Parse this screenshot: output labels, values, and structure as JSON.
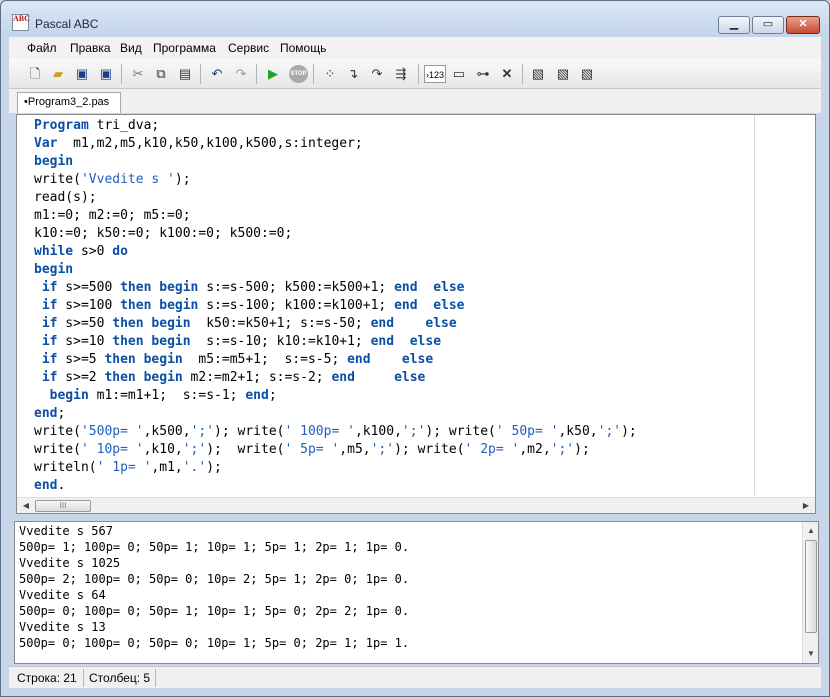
{
  "window": {
    "title": "Pascal ABC",
    "icon_text": "ABC"
  },
  "menu": [
    "Файл",
    "Правка",
    "Вид",
    "Программа",
    "Сервис",
    "Помощь"
  ],
  "toolbar": {
    "icons": [
      "new-file-icon",
      "open-file-icon",
      "save-icon",
      "save-all-icon",
      "cut-icon",
      "copy-icon",
      "paste-icon",
      "undo-icon",
      "redo-icon",
      "run-icon",
      "stop-icon",
      "step-icon",
      "step-into-icon",
      "step-over-icon",
      "goto-icon",
      "insert-number-icon",
      "window-icon",
      "watch-icon",
      "delete-icon",
      "format-left-icon",
      "format-center-icon",
      "format-right-icon"
    ],
    "label_123": "›123",
    "stop_label": "STOP"
  },
  "tab": {
    "label": "•Program3_2.pas"
  },
  "code_lines": [
    [
      [
        "kw",
        "Program"
      ],
      [
        "",
        " tri_dva;"
      ]
    ],
    [
      [
        "kw",
        "Var"
      ],
      [
        "",
        "  m1,m2,m5,k10,k50,k100,k500,s:integer;"
      ]
    ],
    [
      [
        "kw",
        "begin"
      ]
    ],
    [
      [
        "",
        "write("
      ],
      [
        "str",
        "'Vvedite s '"
      ],
      [
        "",
        ");"
      ]
    ],
    [
      [
        "",
        "read(s);"
      ]
    ],
    [
      [
        "",
        "m1:=0; m2:=0; m5:=0;"
      ]
    ],
    [
      [
        "",
        "k10:=0; k50:=0; k100:=0; k500:=0;"
      ]
    ],
    [
      [
        "kw",
        "while"
      ],
      [
        "",
        " s>0 "
      ],
      [
        "kw",
        "do"
      ]
    ],
    [
      [
        "kw",
        "begin"
      ]
    ],
    [
      [
        "",
        " "
      ],
      [
        "kw",
        "if"
      ],
      [
        "",
        " s>=500 "
      ],
      [
        "kw",
        "then begin"
      ],
      [
        "",
        " s:=s-500; k500:=k500+1; "
      ],
      [
        "kw",
        "end"
      ],
      [
        "",
        "  "
      ],
      [
        "kw",
        "else"
      ]
    ],
    [
      [
        "",
        " "
      ],
      [
        "kw",
        "if"
      ],
      [
        "",
        " s>=100 "
      ],
      [
        "kw",
        "then begin"
      ],
      [
        "",
        " s:=s-100; k100:=k100+1; "
      ],
      [
        "kw",
        "end"
      ],
      [
        "",
        "  "
      ],
      [
        "kw",
        "else"
      ]
    ],
    [
      [
        "",
        " "
      ],
      [
        "kw",
        "if"
      ],
      [
        "",
        " s>=50 "
      ],
      [
        "kw",
        "then begin"
      ],
      [
        "",
        "  k50:=k50+1; s:=s-50; "
      ],
      [
        "kw",
        "end"
      ],
      [
        "",
        "    "
      ],
      [
        "kw",
        "else"
      ]
    ],
    [
      [
        "",
        " "
      ],
      [
        "kw",
        "if"
      ],
      [
        "",
        " s>=10 "
      ],
      [
        "kw",
        "then begin"
      ],
      [
        "",
        "  s:=s-10; k10:=k10+1; "
      ],
      [
        "kw",
        "end"
      ],
      [
        "",
        "  "
      ],
      [
        "kw",
        "else"
      ]
    ],
    [
      [
        "",
        " "
      ],
      [
        "kw",
        "if"
      ],
      [
        "",
        " s>=5 "
      ],
      [
        "kw",
        "then begin"
      ],
      [
        "",
        "  m5:=m5+1;  s:=s-5; "
      ],
      [
        "kw",
        "end"
      ],
      [
        "",
        "    "
      ],
      [
        "kw",
        "else"
      ]
    ],
    [
      [
        "",
        " "
      ],
      [
        "kw",
        "if"
      ],
      [
        "",
        " s>=2 "
      ],
      [
        "kw",
        "then begin"
      ],
      [
        "",
        " m2:=m2+1; s:=s-2; "
      ],
      [
        "kw",
        "end"
      ],
      [
        "",
        "     "
      ],
      [
        "kw",
        "else"
      ]
    ],
    [
      [
        "",
        "  "
      ],
      [
        "kw",
        "begin"
      ],
      [
        "",
        " m1:=m1+1;  s:=s-1; "
      ],
      [
        "kw",
        "end"
      ],
      [
        "",
        ";"
      ]
    ],
    [
      [
        "kw",
        "end"
      ],
      [
        "",
        ";"
      ]
    ],
    [
      [
        "",
        "write("
      ],
      [
        "str",
        "'500p= '"
      ],
      [
        "",
        ",k500,"
      ],
      [
        "str",
        "';'"
      ],
      [
        "",
        "); write("
      ],
      [
        "str",
        "' 100p= '"
      ],
      [
        "",
        ",k100,"
      ],
      [
        "str",
        "';'"
      ],
      [
        "",
        "); write("
      ],
      [
        "str",
        "' 50p= '"
      ],
      [
        "",
        ",k50,"
      ],
      [
        "str",
        "';'"
      ],
      [
        "",
        ");"
      ]
    ],
    [
      [
        "",
        "write("
      ],
      [
        "str",
        "' 10p= '"
      ],
      [
        "",
        ",k10,"
      ],
      [
        "str",
        "';'"
      ],
      [
        "",
        ");  write("
      ],
      [
        "str",
        "' 5p= '"
      ],
      [
        "",
        ",m5,"
      ],
      [
        "str",
        "';'"
      ],
      [
        "",
        "); write("
      ],
      [
        "str",
        "' 2p= '"
      ],
      [
        "",
        ",m2,"
      ],
      [
        "str",
        "';'"
      ],
      [
        "",
        ");"
      ]
    ],
    [
      [
        "",
        "writeln("
      ],
      [
        "str",
        "' 1p= '"
      ],
      [
        "",
        ",m1,"
      ],
      [
        "str",
        "'.'"
      ],
      [
        "",
        ");"
      ]
    ],
    [
      [
        "kw",
        "end"
      ],
      [
        "",
        "."
      ]
    ]
  ],
  "output_lines": [
    "Vvedite s 567",
    "500p= 1; 100p= 0; 50p= 1; 10p= 1; 5p= 1; 2p= 1; 1p= 0.",
    "Vvedite s 1025",
    "500p= 2; 100p= 0; 50p= 0; 10p= 2; 5p= 1; 2p= 0; 1p= 0.",
    "Vvedite s 64",
    "500p= 0; 100p= 0; 50p= 1; 10p= 1; 5p= 0; 2p= 2; 1p= 0.",
    "Vvedite s 13",
    "500p= 0; 100p= 0; 50p= 0; 10p= 1; 5p= 0; 2p= 1; 1p= 1."
  ],
  "status": {
    "line": "Строка: 21",
    "column": "Столбец: 5"
  }
}
